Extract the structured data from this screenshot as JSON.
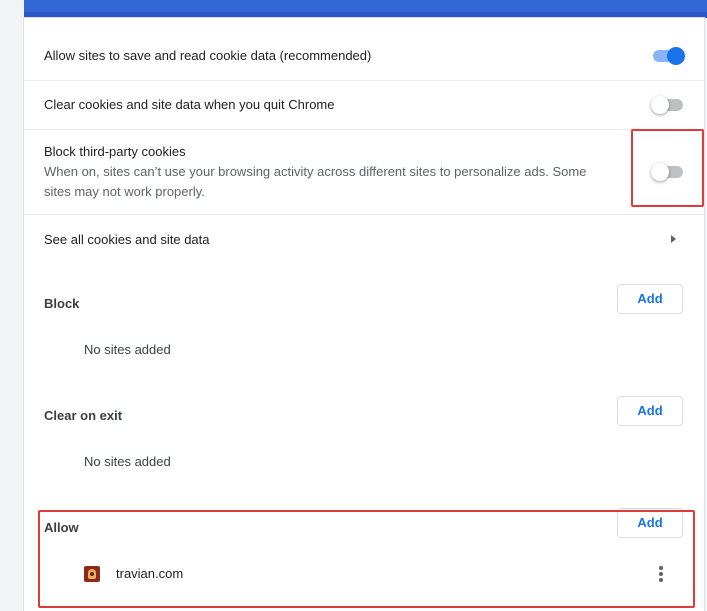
{
  "colors": {
    "accent": "#1a73e8",
    "header": "#3367d6",
    "highlight_border": "#e03b3b"
  },
  "settings": {
    "allow_cookies": {
      "label": "Allow sites to save and read cookie data (recommended)",
      "enabled": true
    },
    "clear_on_quit": {
      "label": "Clear cookies and site data when you quit Chrome",
      "enabled": false
    },
    "block_third_party": {
      "label": "Block third-party cookies",
      "description": "When on, sites can’t use your browsing activity across different sites to personalize ads. Some sites may not work properly.",
      "enabled": false
    },
    "see_all": {
      "label": "See all cookies and site data",
      "icon": "chevron-right-icon"
    }
  },
  "sections": {
    "block": {
      "title": "Block",
      "add_label": "Add",
      "empty_text": "No sites added"
    },
    "clear_on_exit": {
      "title": "Clear on exit",
      "add_label": "Add",
      "empty_text": "No sites added"
    },
    "allow": {
      "title": "Allow",
      "add_label": "Add",
      "sites": [
        {
          "name": "travian.com",
          "icon": "site-favicon",
          "menu_icon": "more-vert-icon"
        }
      ]
    }
  }
}
